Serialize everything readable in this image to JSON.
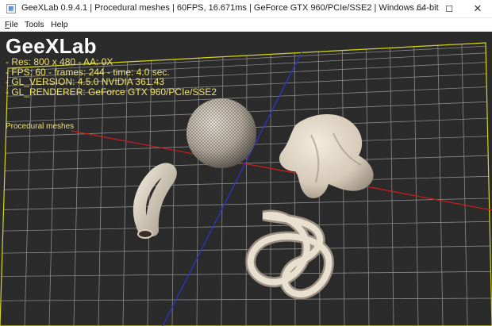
{
  "window": {
    "title": "GeeXLab 0.9.4.1 | Procedural meshes | 60FPS, 16.671ms | GeForce GTX 960/PCIe/SSE2 | Windows 64-bit",
    "icon": "geexlab-app-icon",
    "controls": {
      "minimize": "—",
      "maximize": "☐",
      "close": "✕"
    }
  },
  "menu": [
    {
      "underline": "F",
      "rest": "ile"
    },
    {
      "underline": "",
      "rest": "Tools"
    },
    {
      "underline": "",
      "rest": "Help"
    }
  ],
  "hud": {
    "title": "GeeXLab",
    "lines": [
      "- Res: 800 x 480 - AA: 0X",
      "- FPS: 60 - frames: 244 - time: 4.0 sec.",
      "- GL_VERSION: 4.5.0 NVIDIA 361.43",
      "- GL_RENDERER: GeForce GTX 960/PCIe/SSE2"
    ],
    "scene_label": "Procedural meshes"
  },
  "colors": {
    "viewport_bg": "#2b2b2b",
    "grid": "#8a8a8a",
    "grid_border": "#d6d61c",
    "axis_x": "#c81e1e",
    "axis_z": "#2a35c8",
    "mesh": "#e6dccb",
    "hud_text": "#f0e36a"
  }
}
